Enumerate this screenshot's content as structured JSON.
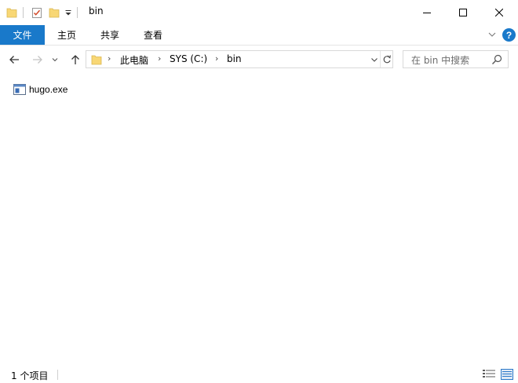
{
  "window": {
    "title": "bin",
    "controls": {
      "minimize_icon": "minimize-icon",
      "maximize_icon": "maximize-icon",
      "close_icon": "close-icon"
    }
  },
  "quick_access_toolbar": {
    "icons": [
      "folder-icon",
      "properties-icon",
      "new-folder-icon",
      "customize-dropdown-icon"
    ]
  },
  "ribbon": {
    "tabs": [
      {
        "label": "文件",
        "active": true
      },
      {
        "label": "主页"
      },
      {
        "label": "共享"
      },
      {
        "label": "查看"
      }
    ],
    "help_label": "?"
  },
  "navigation": {
    "breadcrumb": [
      "此电脑",
      "SYS (C:)",
      "bin"
    ],
    "search_placeholder": "在 bin 中搜索"
  },
  "files": [
    {
      "name": "hugo.exe",
      "icon": "exe-file-icon"
    }
  ],
  "status_bar": {
    "item_count": "1 个项目",
    "views": [
      "details-view-icon",
      "large-icons-view-icon"
    ]
  },
  "colors": {
    "accent": "#1979ca",
    "folder": "#f8d775",
    "border": "#d9d9d9"
  }
}
